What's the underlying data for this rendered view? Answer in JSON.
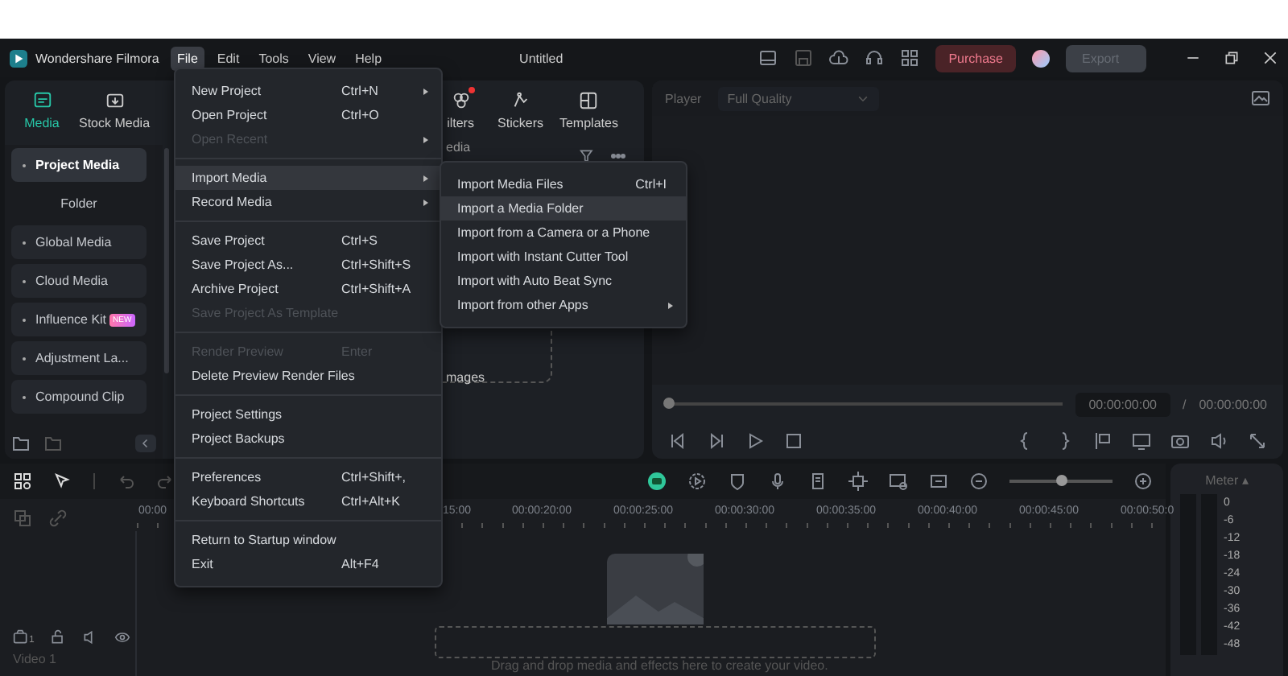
{
  "title_bar": {
    "app_name": "Wondershare Filmora",
    "menus": [
      {
        "label": "File",
        "selected": true
      },
      {
        "label": "Edit",
        "selected": false
      },
      {
        "label": "Tools",
        "selected": false
      },
      {
        "label": "View",
        "selected": false
      },
      {
        "label": "Help",
        "selected": false
      }
    ],
    "document_title": "Untitled",
    "purchase": "Purchase",
    "export": "Export"
  },
  "panel_tabs": [
    {
      "label": "Media",
      "selected": true
    },
    {
      "label": "Stock Media",
      "selected": false
    },
    {
      "label": "ilters",
      "selected": false,
      "dot": true
    },
    {
      "label": "Stickers",
      "selected": false
    },
    {
      "label": "Templates",
      "selected": false
    }
  ],
  "sidebar": [
    {
      "label": "Project Media",
      "selected": true,
      "children": [
        {
          "label": "Folder",
          "selected": false
        }
      ]
    },
    {
      "label": "Global Media",
      "selected": false
    },
    {
      "label": "Cloud Media",
      "selected": false
    },
    {
      "label": "Influence Kit",
      "selected": false,
      "badge": "NEW"
    },
    {
      "label": "Adjustment La...",
      "selected": false
    },
    {
      "label": "Compound Clip",
      "selected": false
    }
  ],
  "media_area": {
    "header": "edia",
    "hint": "mages"
  },
  "player": {
    "label": "Player",
    "quality": "Full Quality",
    "level": 0,
    "current_time": "00:00:00:00",
    "separator": "/",
    "total_time": "00:00:00:00"
  },
  "timeline": {
    "zoom": {
      "level": 0.5
    },
    "ruler": [
      "00:00",
      "15:00",
      "00:00:20:00",
      "00:00:25:00",
      "00:00:30:00",
      "00:00:35:00",
      "00:00:40:00",
      "00:00:45:00",
      "00:00:50:0"
    ],
    "track_number": "1",
    "track_label": "Video 1",
    "drop_hint": "Drag and drop media and effects here to create your video."
  },
  "meter": {
    "label": "Meter ▴",
    "scale": [
      "0",
      "-6",
      "-12",
      "-18",
      "-24",
      "-30",
      "-36",
      "-42",
      "-48"
    ]
  },
  "file_menu": [
    {
      "kind": "item",
      "label": "New Project",
      "shortcut": "Ctrl+N",
      "submenu": true,
      "disabled": false,
      "selected": false
    },
    {
      "kind": "item",
      "label": "Open Project",
      "shortcut": "Ctrl+O",
      "submenu": false,
      "disabled": false,
      "selected": false
    },
    {
      "kind": "item",
      "label": "Open Recent",
      "submenu": true,
      "disabled": true,
      "selected": false
    },
    {
      "kind": "separator"
    },
    {
      "kind": "item",
      "label": "Import Media",
      "submenu": true,
      "disabled": false,
      "selected": true
    },
    {
      "kind": "item",
      "label": "Record Media",
      "submenu": true,
      "disabled": false,
      "selected": false
    },
    {
      "kind": "separator"
    },
    {
      "kind": "item",
      "label": "Save Project",
      "shortcut": "Ctrl+S",
      "submenu": false,
      "disabled": false,
      "selected": false
    },
    {
      "kind": "item",
      "label": "Save Project As...",
      "shortcut": "Ctrl+Shift+S",
      "submenu": false,
      "disabled": false,
      "selected": false
    },
    {
      "kind": "item",
      "label": "Archive Project",
      "shortcut": "Ctrl+Shift+A",
      "submenu": false,
      "disabled": false,
      "selected": false
    },
    {
      "kind": "item",
      "label": "Save Project As Template",
      "submenu": false,
      "disabled": true,
      "selected": false
    },
    {
      "kind": "separator"
    },
    {
      "kind": "item",
      "label": "Render Preview",
      "shortcut": "Enter",
      "submenu": false,
      "disabled": true,
      "selected": false
    },
    {
      "kind": "item",
      "label": "Delete Preview Render Files",
      "submenu": false,
      "disabled": false,
      "selected": false
    },
    {
      "kind": "separator"
    },
    {
      "kind": "item",
      "label": "Project Settings",
      "submenu": false,
      "disabled": false,
      "selected": false
    },
    {
      "kind": "item",
      "label": "Project Backups",
      "submenu": false,
      "disabled": false,
      "selected": false
    },
    {
      "kind": "separator"
    },
    {
      "kind": "item",
      "label": "Preferences",
      "shortcut": "Ctrl+Shift+,",
      "submenu": false,
      "disabled": false,
      "selected": false
    },
    {
      "kind": "item",
      "label": "Keyboard Shortcuts",
      "shortcut": "Ctrl+Alt+K",
      "submenu": false,
      "disabled": false,
      "selected": false
    },
    {
      "kind": "separator"
    },
    {
      "kind": "item",
      "label": "Return to Startup window",
      "submenu": false,
      "disabled": false,
      "selected": false
    },
    {
      "kind": "item",
      "label": "Exit",
      "shortcut": "Alt+F4",
      "submenu": false,
      "disabled": false,
      "selected": false
    }
  ],
  "import_submenu": [
    {
      "kind": "item",
      "label": "Import Media Files",
      "shortcut": "Ctrl+I",
      "submenu": false,
      "disabled": false,
      "selected": false
    },
    {
      "kind": "item",
      "label": "Import a Media Folder",
      "submenu": false,
      "disabled": false,
      "selected": true
    },
    {
      "kind": "item",
      "label": "Import from a Camera or a Phone",
      "submenu": false,
      "disabled": false,
      "selected": false
    },
    {
      "kind": "item",
      "label": "Import with Instant Cutter Tool",
      "submenu": false,
      "disabled": false,
      "selected": false
    },
    {
      "kind": "item",
      "label": "Import with Auto Beat Sync",
      "submenu": false,
      "disabled": false,
      "selected": false
    },
    {
      "kind": "item",
      "label": "Import from other Apps",
      "submenu": true,
      "disabled": false,
      "selected": false
    }
  ]
}
